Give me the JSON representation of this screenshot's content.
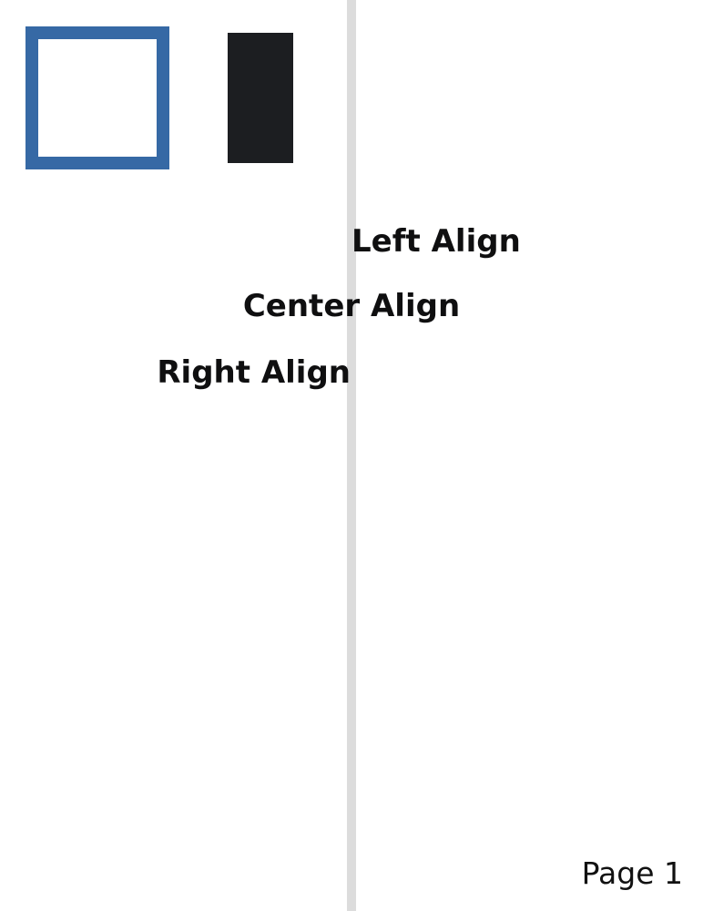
{
  "document": {
    "alignment_samples": {
      "left": "Left Align",
      "center": "Center Align",
      "right": "Right Align"
    },
    "footer": {
      "page_label": "Page 1"
    }
  },
  "colors": {
    "accent_blue": "#3669a5",
    "dark_block": "#1c1e21",
    "guide_gray": "#dcdcdc",
    "text": "#111111"
  }
}
